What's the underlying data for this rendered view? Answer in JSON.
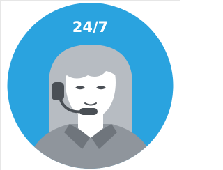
{
  "badge": {
    "label": "24/7"
  },
  "colors": {
    "circle": "#2aa3df",
    "hair": "#b7bcc2",
    "skin": "#ffffff",
    "shirt": "#8f959c",
    "shirt_dark": "#6f757c",
    "headset": "#4a4f55",
    "eyes": "#4a4f55"
  },
  "icons": {
    "main": "customer-support-agent-icon",
    "headset": "headset-icon"
  }
}
